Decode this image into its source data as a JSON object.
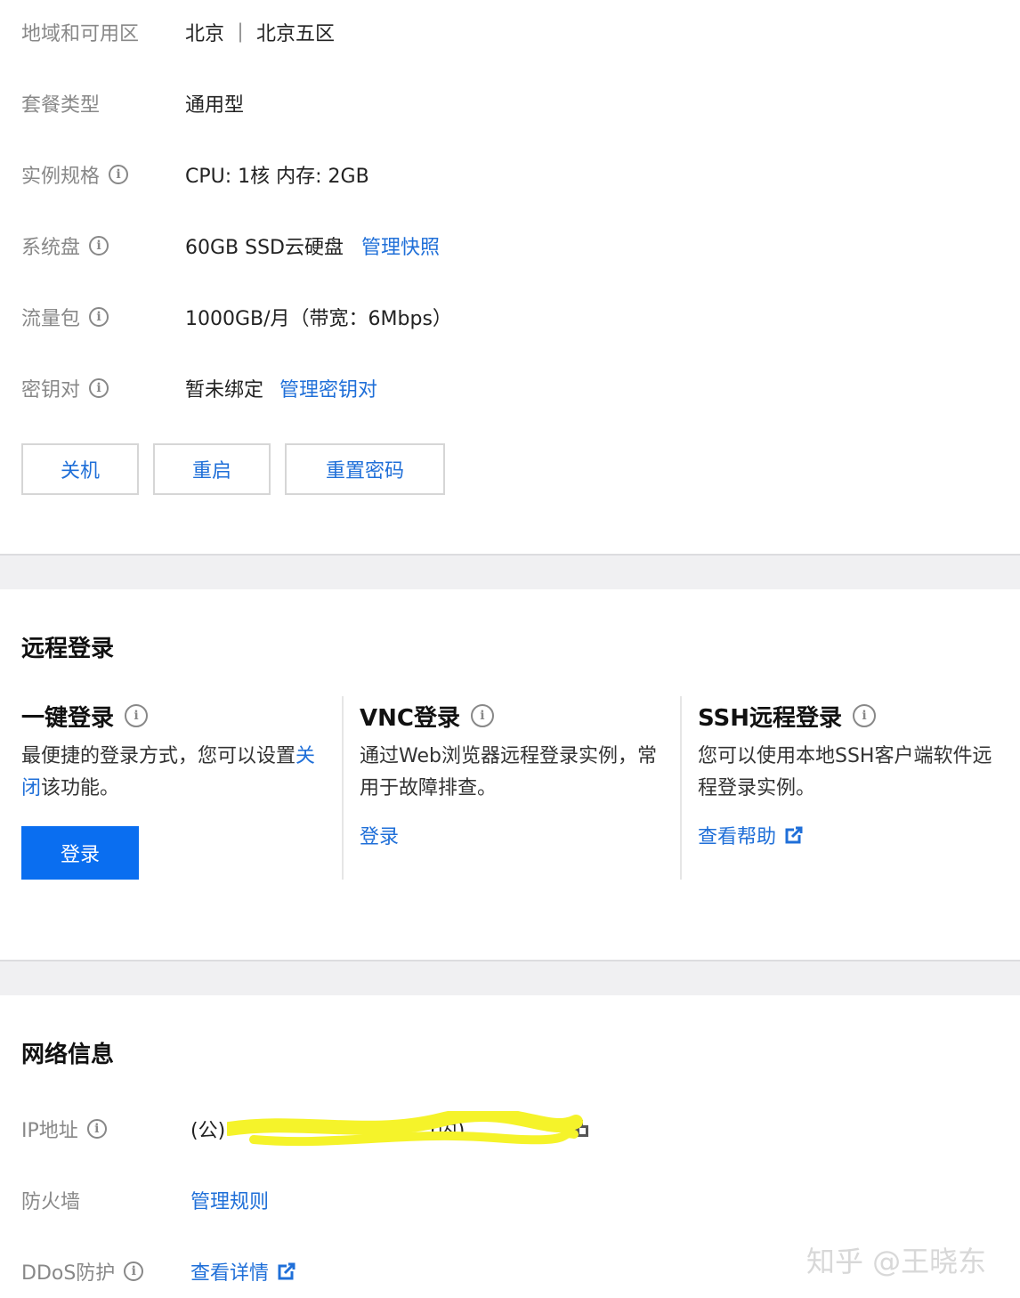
{
  "specs": [
    {
      "label": "地域和可用区",
      "value": "北京 ｜ 北京五区",
      "link": "",
      "info": false
    },
    {
      "label": "套餐类型",
      "value": "通用型",
      "link": "",
      "info": false
    },
    {
      "label": "实例规格",
      "value": "CPU: 1核 内存: 2GB",
      "link": "",
      "info": true
    },
    {
      "label": "系统盘",
      "value": "60GB SSD云硬盘",
      "link": "管理快照",
      "info": true
    },
    {
      "label": "流量包",
      "value": "1000GB/月（带宽：6Mbps）",
      "link": "",
      "info": true
    },
    {
      "label": "密钥对",
      "value": "暂未绑定",
      "link": "管理密钥对",
      "info": true
    }
  ],
  "actions": {
    "shutdown": "关机",
    "restart": "重启",
    "reset_password": "重置密码"
  },
  "remote": {
    "title": "远程登录",
    "one_click": {
      "title": "一键登录",
      "desc_prefix": "最便捷的登录方式，您可以设置",
      "desc_link": "关闭",
      "desc_suffix": "该功能。",
      "button": "登录"
    },
    "vnc": {
      "title": "VNC登录",
      "desc": "通过Web浏览器远程登录实例，常用于故障排查。",
      "link": "登录"
    },
    "ssh": {
      "title": "SSH远程登录",
      "desc": "您可以使用本地SSH客户端软件远程登录实例。",
      "link": "查看帮助"
    }
  },
  "network": {
    "title": "网络信息",
    "ip_label": "IP地址",
    "public_prefix": "(公)",
    "private_prefix": "(内)",
    "firewall_label": "防火墙",
    "firewall_link": "管理规则",
    "ddos_label": "DDoS防护",
    "ddos_link": "查看详情"
  },
  "watermark": "知乎 @王晓东",
  "colors": {
    "link": "#1f6fd8",
    "primary": "#0a6ef0",
    "highlight": "#f5f32a"
  }
}
